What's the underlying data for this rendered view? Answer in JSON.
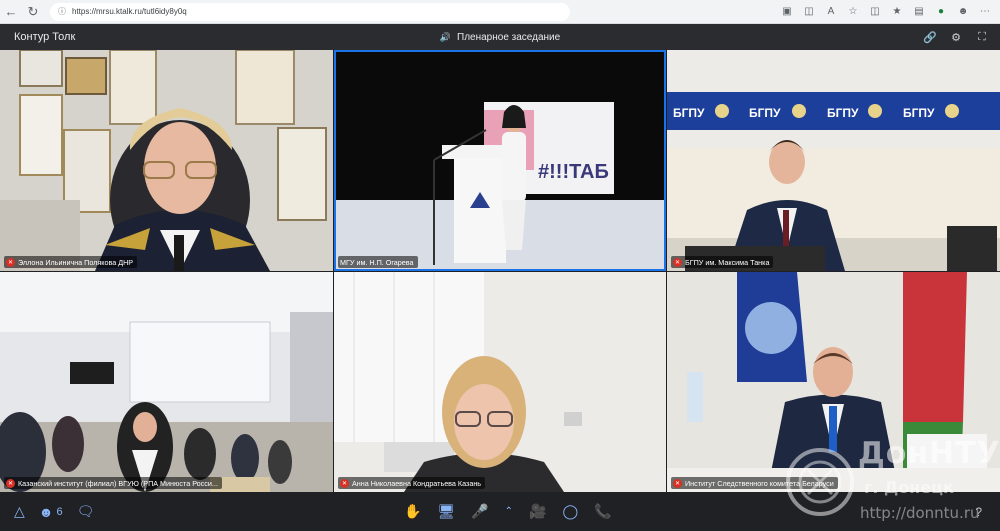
{
  "browser": {
    "url": "https://mrsu.ktalk.ru/tutl6idy8y0q"
  },
  "app": {
    "title": "Контур Толк",
    "meeting_title": "Пленарное заседание"
  },
  "tiles": [
    {
      "label": "Эллона Ильинична Полякова ДНР",
      "muted": true
    },
    {
      "label": "МГУ им. Н.П. Огарева",
      "muted": false
    },
    {
      "label": "БГПУ им. Максима Танка",
      "muted": true
    },
    {
      "label": "Казанский институт (филиал) ВГУЮ (РПА Минюста Росси...",
      "muted": true
    },
    {
      "label": "Анна Николаевна Кондратьева Казань",
      "muted": true
    },
    {
      "label": "Институт Следственного комитета Беларуси",
      "muted": true
    }
  ],
  "scenes": {
    "bgpu_banner_text": "БГПУ",
    "stage_banner_text": "#!!!ТАБ"
  },
  "toolbar": {
    "participants_count": "6"
  },
  "watermark": {
    "line1": "ДонНТУ",
    "line2": "г. Донецк",
    "line3": "http://donntu.ru"
  },
  "colors": {
    "accent": "#1a73e8",
    "muted_badge": "#d93025",
    "toolbar_icon": "#8ab4f8",
    "end_call": "#ea4335"
  }
}
